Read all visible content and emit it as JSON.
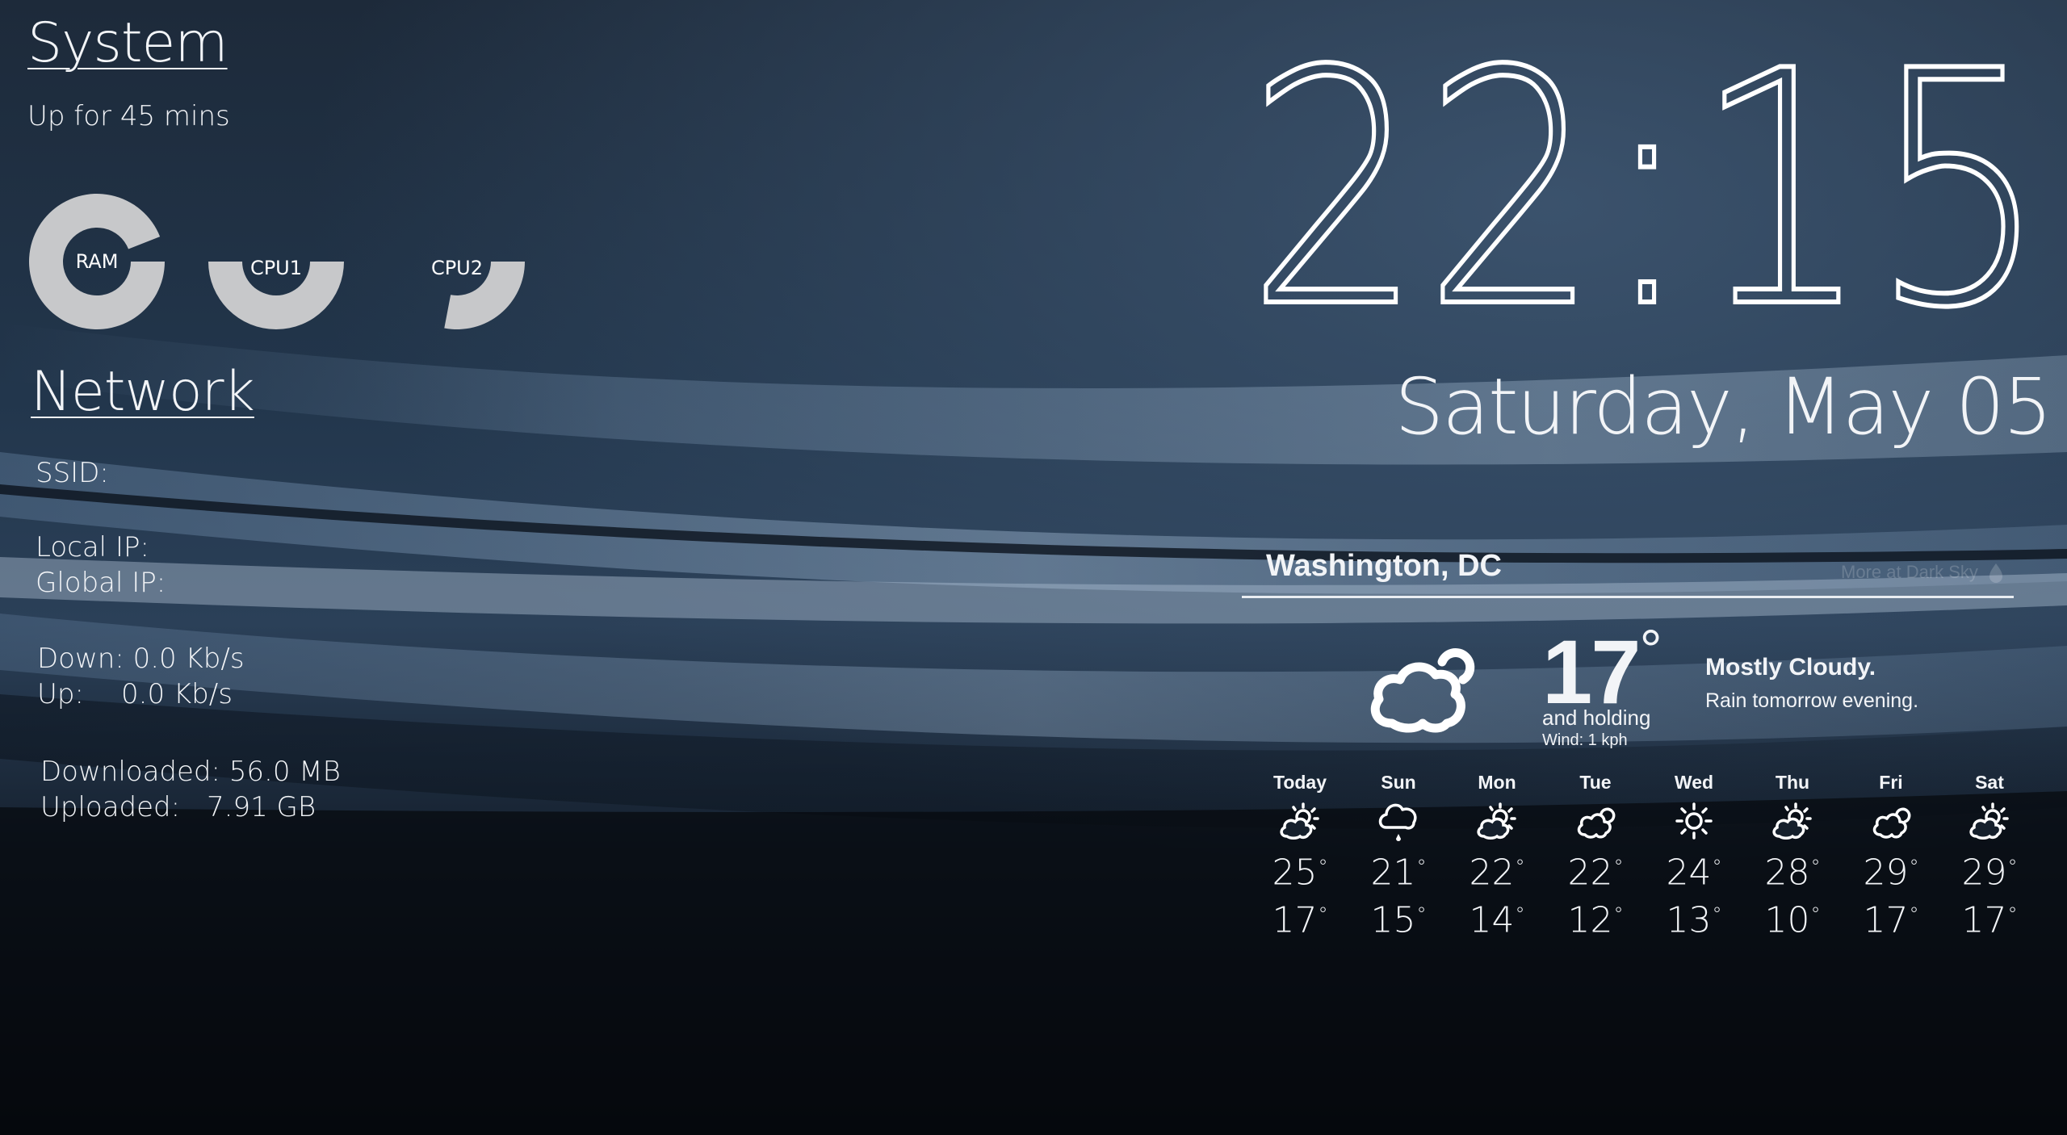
{
  "system": {
    "title": "System",
    "uptime": "Up for 45 mins",
    "gauges": [
      {
        "label": "RAM",
        "fraction": 0.94
      },
      {
        "label": "CPU1",
        "fraction": 0.5
      },
      {
        "label": "CPU2",
        "fraction": 0.28
      }
    ]
  },
  "network": {
    "title": "Network",
    "ssid_label": "SSID:",
    "ssid_value": "",
    "local_ip_label": "Local IP:",
    "local_ip_value": "",
    "global_ip_label": "Global IP:",
    "global_ip_value": "",
    "down_label": "Down:",
    "down_value": "0.0 Kb/s",
    "up_label": "Up:",
    "up_value": "0.0 Kb/s",
    "downloaded_label": "Downloaded:",
    "downloaded_value": "56.0 MB",
    "uploaded_label": "Uploaded:",
    "uploaded_value": "7.91 GB"
  },
  "clock": {
    "time": "22:15",
    "date": "Saturday, May 05"
  },
  "weather": {
    "city": "Washington, DC",
    "credit": "More at Dark Sky",
    "current_temp": "17",
    "trend": "and holding",
    "wind": "Wind: 1 kph",
    "summary": "Mostly Cloudy.",
    "detail": "Rain tomorrow evening.",
    "current_icon": "cloud-icon",
    "forecast": [
      {
        "day": "Today",
        "icon": "partly-cloudy-icon",
        "high": "25",
        "low": "17"
      },
      {
        "day": "Sun",
        "icon": "rain-icon",
        "high": "21",
        "low": "15"
      },
      {
        "day": "Mon",
        "icon": "partly-cloudy-icon",
        "high": "22",
        "low": "14"
      },
      {
        "day": "Tue",
        "icon": "cloud-icon",
        "high": "22",
        "low": "12"
      },
      {
        "day": "Wed",
        "icon": "sun-icon",
        "high": "24",
        "low": "13"
      },
      {
        "day": "Thu",
        "icon": "partly-cloudy-icon",
        "high": "28",
        "low": "10"
      },
      {
        "day": "Fri",
        "icon": "cloud-icon",
        "high": "29",
        "low": "17"
      },
      {
        "day": "Sat",
        "icon": "partly-cloudy-icon",
        "high": "29",
        "low": "17"
      }
    ]
  },
  "colors": {
    "gauge": "#c7c8ca",
    "text": "#f2f4f7",
    "rule": "#e9edf2"
  }
}
